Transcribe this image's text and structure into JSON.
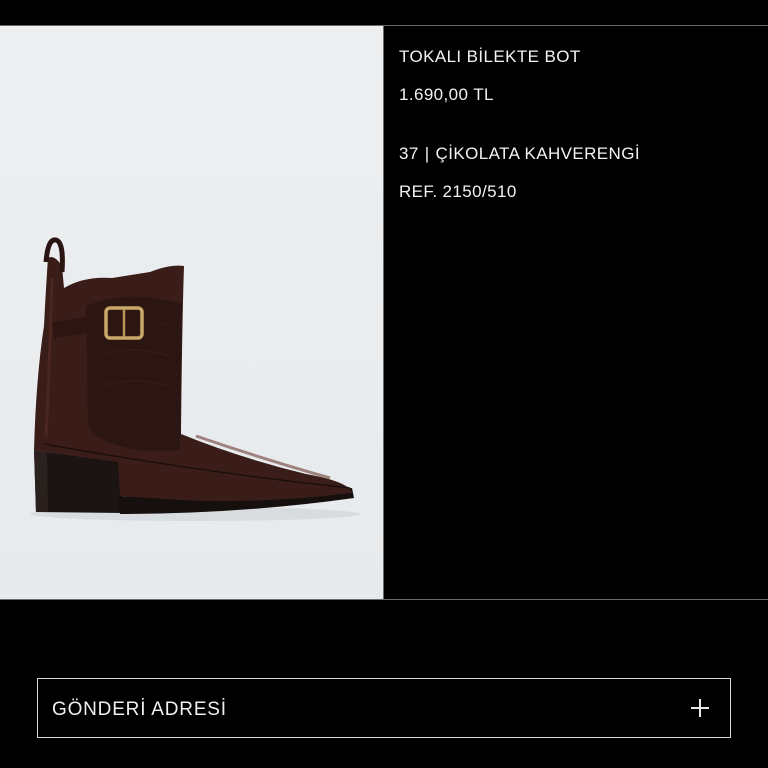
{
  "product": {
    "title": "TOKALI BİLEKTE BOT",
    "price": "1.690,00 TL",
    "size": "37",
    "separator": "|",
    "color": "ÇİKOLATA KAHVERENGİ",
    "reference": "REF. 2150/510",
    "image_subject": "chocolate brown ankle boot with gold buckle"
  },
  "shipping": {
    "label": "GÖNDERİ ADRESİ",
    "icon": "plus-icon"
  }
}
